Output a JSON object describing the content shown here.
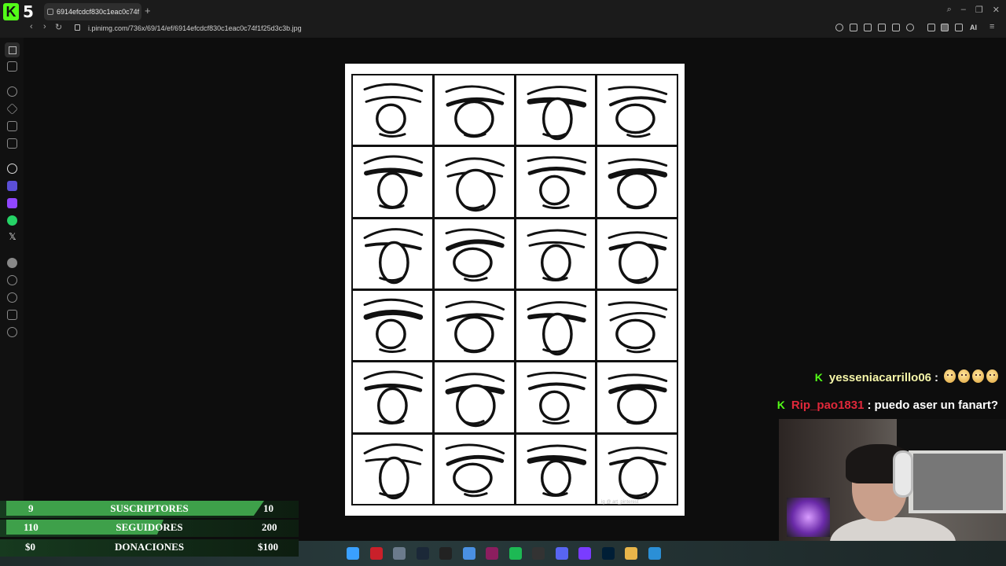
{
  "browser": {
    "tab_title": "6914efcdcf830c1eac0c74f",
    "new_tab": "+",
    "url": "i.pinimg.com/736x/69/14/ef/6914efcdcf830c1eac0c74f1f25d3c3b.jpg",
    "ai_label": "AI"
  },
  "logo": {
    "k": "K",
    "five": "5"
  },
  "image": {
    "watermark": "ig @ art_pinterest"
  },
  "chat": [
    {
      "user": "yesseniacarrillo06",
      "sep": ":",
      "message": "",
      "emoji_count": 4
    },
    {
      "user": "Rip_pao1831",
      "sep": ":",
      "message": "puedo aser un fanart?"
    }
  ],
  "stats": [
    {
      "current": "9",
      "label": "SUSCRIPTORES",
      "goal": "10",
      "progress": 0.9
    },
    {
      "current": "110",
      "label": "SEGUIDORES",
      "goal": "200",
      "progress": 0.55
    },
    {
      "current": "$0",
      "label": "DONACIONES",
      "goal": "$100",
      "progress": 0.0
    }
  ],
  "sidebar_icons": [
    "home-icon",
    "gamepad-icon",
    "eye-icon",
    "diamond-icon",
    "image-icon",
    "camera-icon",
    "chatgpt-icon",
    "copilot-icon",
    "twitch-icon",
    "whatsapp-icon",
    "x-icon",
    "spotify-icon",
    "heart-icon",
    "history-icon",
    "extensions-icon",
    "settings-icon"
  ],
  "taskbar_icons": [
    "windows-start-icon",
    "file-explorer-icon",
    "store-icon",
    "steam-icon",
    "tiktok-icon",
    "files-icon",
    "krita-icon",
    "spotify-icon",
    "obs-icon",
    "discord-icon",
    "app-icon",
    "photoshop-icon",
    "folder-icon",
    "paint-icon"
  ],
  "colors": {
    "kick_green": "#53fc18",
    "stat_green": "#3ea04a",
    "user1": "#f5f5a8",
    "user2": "#e0283a"
  }
}
